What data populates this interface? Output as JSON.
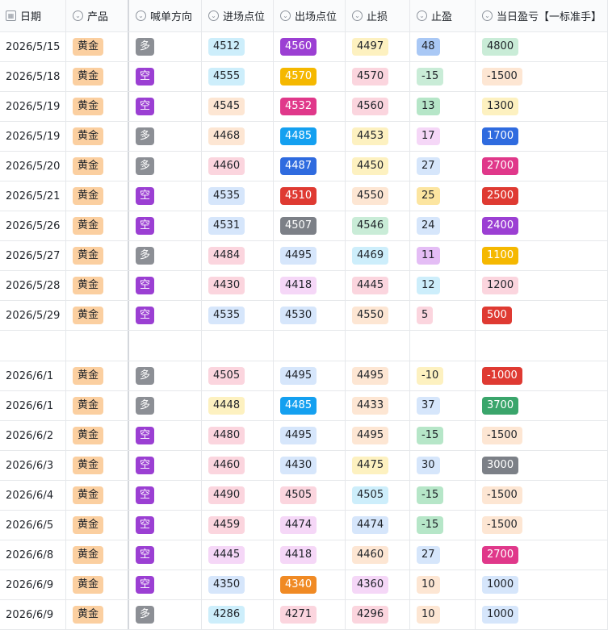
{
  "columns": [
    {
      "icon": "calendar-icon",
      "label": "日期"
    },
    {
      "icon": "single-select-icon",
      "label": "产品"
    },
    {
      "icon": "single-select-icon",
      "label": "喊单方向"
    },
    {
      "icon": "single-select-icon",
      "label": "进场点位"
    },
    {
      "icon": "single-select-icon",
      "label": "出场点位"
    },
    {
      "icon": "single-select-icon",
      "label": "止损"
    },
    {
      "icon": "single-select-icon",
      "label": "止盈"
    },
    {
      "icon": "single-select-icon",
      "label": "当日盈亏【一标准手】"
    }
  ],
  "colors": {
    "gold": "#fbcfa0",
    "long": "#8c8f95",
    "short": "#9b3fd3",
    "lightblue": "#cdeefb",
    "lightpink": "#fbd5de",
    "lightpurple": "#f5d7f7",
    "lightyellow": "#fdf1c0",
    "lightpeach": "#fde6d3",
    "lightgreen": "#c9ecd7",
    "lightsky": "#d6e6fb",
    "midgreen": "#b6e6c8",
    "midblue": "#a9c8f5",
    "midyellow": "#fce5a0",
    "midpurple": "#e4bdf5",
    "purple": "#9b3fd3",
    "orange": "#f5b800",
    "magenta": "#e0388a",
    "blue": "#14a0f0",
    "royal": "#2f6bdf",
    "red": "#df3a32",
    "gray": "#7c8087",
    "green": "#3aa56b",
    "deeporange": "#f08a24"
  },
  "rows": [
    {
      "date": "2026/5/15",
      "product": "黄金",
      "dir": "多",
      "entry": "4512",
      "exit": "4560",
      "sl": "4497",
      "tp": "48",
      "pnl": "4800",
      "ec": "lightblue",
      "xc": "purple",
      "sc": "lightyellow",
      "tc": "midblue",
      "pc": "lightgreen"
    },
    {
      "date": "2026/5/18",
      "product": "黄金",
      "dir": "空",
      "entry": "4555",
      "exit": "4570",
      "sl": "4570",
      "tp": "-15",
      "pnl": "-1500",
      "ec": "lightblue",
      "xc": "orange",
      "sc": "lightpink",
      "tc": "lightgreen",
      "pc": "lightpeach"
    },
    {
      "date": "2026/5/19",
      "product": "黄金",
      "dir": "空",
      "entry": "4545",
      "exit": "4532",
      "sl": "4560",
      "tp": "13",
      "pnl": "1300",
      "ec": "lightpeach",
      "xc": "magenta",
      "sc": "lightpink",
      "tc": "midgreen",
      "pc": "lightyellow"
    },
    {
      "date": "2026/5/19",
      "product": "黄金",
      "dir": "多",
      "entry": "4468",
      "exit": "4485",
      "sl": "4453",
      "tp": "17",
      "pnl": "1700",
      "ec": "lightpeach",
      "xc": "blue",
      "sc": "lightyellow",
      "tc": "lightpurple",
      "pc": "royal"
    },
    {
      "date": "2026/5/20",
      "product": "黄金",
      "dir": "多",
      "entry": "4460",
      "exit": "4487",
      "sl": "4450",
      "tp": "27",
      "pnl": "2700",
      "ec": "lightpink",
      "xc": "royal",
      "sc": "lightyellow",
      "tc": "lightsky",
      "pc": "magenta"
    },
    {
      "date": "2026/5/21",
      "product": "黄金",
      "dir": "空",
      "entry": "4535",
      "exit": "4510",
      "sl": "4550",
      "tp": "25",
      "pnl": "2500",
      "ec": "lightsky",
      "xc": "red",
      "sc": "lightpeach",
      "tc": "midyellow",
      "pc": "red"
    },
    {
      "date": "2026/5/26",
      "product": "黄金",
      "dir": "空",
      "entry": "4531",
      "exit": "4507",
      "sl": "4546",
      "tp": "24",
      "pnl": "2400",
      "ec": "lightsky",
      "xc": "gray",
      "sc": "lightgreen",
      "tc": "lightsky",
      "pc": "purple"
    },
    {
      "date": "2026/5/27",
      "product": "黄金",
      "dir": "多",
      "entry": "4484",
      "exit": "4495",
      "sl": "4469",
      "tp": "11",
      "pnl": "1100",
      "ec": "lightpink",
      "xc": "lightsky",
      "sc": "lightblue",
      "tc": "midpurple",
      "pc": "orange"
    },
    {
      "date": "2026/5/28",
      "product": "黄金",
      "dir": "空",
      "entry": "4430",
      "exit": "4418",
      "sl": "4445",
      "tp": "12",
      "pnl": "1200",
      "ec": "lightpink",
      "xc": "lightpurple",
      "sc": "lightpink",
      "tc": "lightblue",
      "pc": "lightpink"
    },
    {
      "date": "2026/5/29",
      "product": "黄金",
      "dir": "空",
      "entry": "4535",
      "exit": "4530",
      "sl": "4550",
      "tp": "5",
      "pnl": "500",
      "ec": "lightsky",
      "xc": "lightsky",
      "sc": "lightpeach",
      "tc": "lightpink",
      "pc": "red"
    },
    {
      "spacer": true
    },
    {
      "date": "2026/6/1",
      "product": "黄金",
      "dir": "多",
      "entry": "4505",
      "exit": "4495",
      "sl": "4495",
      "tp": "-10",
      "pnl": "-1000",
      "ec": "lightpink",
      "xc": "lightsky",
      "sc": "lightpeach",
      "tc": "lightyellow",
      "pc": "red"
    },
    {
      "date": "2026/6/1",
      "product": "黄金",
      "dir": "多",
      "entry": "4448",
      "exit": "4485",
      "sl": "4433",
      "tp": "37",
      "pnl": "3700",
      "ec": "lightyellow",
      "xc": "blue",
      "sc": "lightpeach",
      "tc": "lightsky",
      "pc": "green"
    },
    {
      "date": "2026/6/2",
      "product": "黄金",
      "dir": "空",
      "entry": "4480",
      "exit": "4495",
      "sl": "4495",
      "tp": "-15",
      "pnl": "-1500",
      "ec": "lightpink",
      "xc": "lightsky",
      "sc": "lightpeach",
      "tc": "midgreen",
      "pc": "lightpeach"
    },
    {
      "date": "2026/6/3",
      "product": "黄金",
      "dir": "空",
      "entry": "4460",
      "exit": "4430",
      "sl": "4475",
      "tp": "30",
      "pnl": "3000",
      "ec": "lightpink",
      "xc": "lightsky",
      "sc": "lightyellow",
      "tc": "lightsky",
      "pc": "gray"
    },
    {
      "date": "2026/6/4",
      "product": "黄金",
      "dir": "空",
      "entry": "4490",
      "exit": "4505",
      "sl": "4505",
      "tp": "-15",
      "pnl": "-1500",
      "ec": "lightpink",
      "xc": "lightpink",
      "sc": "lightblue",
      "tc": "midgreen",
      "pc": "lightpeach"
    },
    {
      "date": "2026/6/5",
      "product": "黄金",
      "dir": "空",
      "entry": "4459",
      "exit": "4474",
      "sl": "4474",
      "tp": "-15",
      "pnl": "-1500",
      "ec": "lightpink",
      "xc": "lightpurple",
      "sc": "lightsky",
      "tc": "midgreen",
      "pc": "lightpeach"
    },
    {
      "date": "2026/6/8",
      "product": "黄金",
      "dir": "空",
      "entry": "4445",
      "exit": "4418",
      "sl": "4460",
      "tp": "27",
      "pnl": "2700",
      "ec": "lightpurple",
      "xc": "lightpurple",
      "sc": "lightpeach",
      "tc": "lightsky",
      "pc": "magenta"
    },
    {
      "date": "2026/6/9",
      "product": "黄金",
      "dir": "空",
      "entry": "4350",
      "exit": "4340",
      "sl": "4360",
      "tp": "10",
      "pnl": "1000",
      "ec": "lightsky",
      "xc": "deeporange",
      "sc": "lightpurple",
      "tc": "lightpeach",
      "pc": "lightsky"
    },
    {
      "date": "2026/6/9",
      "product": "黄金",
      "dir": "多",
      "entry": "4286",
      "exit": "4271",
      "sl": "4296",
      "tp": "10",
      "pnl": "1000",
      "ec": "lightblue",
      "xc": "lightpink",
      "sc": "lightpink",
      "tc": "lightpeach",
      "pc": "lightsky"
    }
  ]
}
